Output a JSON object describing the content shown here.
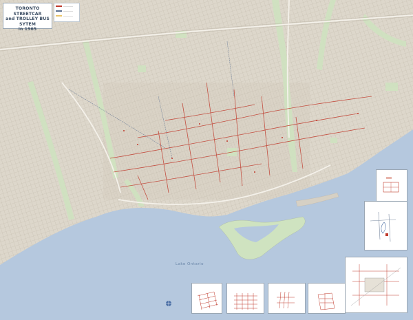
{
  "title": {
    "line1": "TORONTO STREETCAR",
    "line2": "and TROLLEY BUS SYTEM",
    "line3": "in 1965"
  },
  "lake_label": "Lake Ontario",
  "colors": {
    "land": "#e8e4da",
    "urban": "#d9d3c7",
    "streets": "#c9c1b3",
    "parks": "#cfe3c0",
    "water": "#b5c8de",
    "streetcar": "#c0392b",
    "trolley": "#5a6f8f",
    "highway": "#ffffff"
  },
  "legend_icons": [
    "streetcar-line-swatch",
    "trolley-bus-line-swatch",
    "highway-swatch"
  ]
}
